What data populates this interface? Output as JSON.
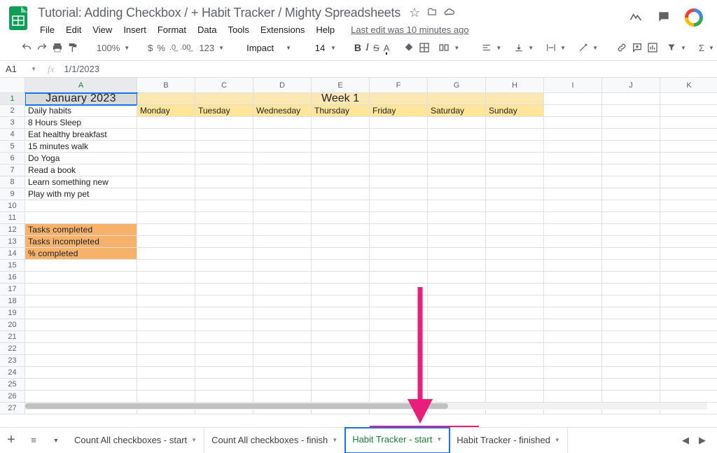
{
  "doc": {
    "title": "Tutorial: Adding Checkbox / + Habit Tracker / Mighty Spreadsheets"
  },
  "menu": [
    "File",
    "Edit",
    "View",
    "Insert",
    "Format",
    "Data",
    "Tools",
    "Extensions",
    "Help"
  ],
  "last_edit": "Last edit was 10 minutes ago",
  "toolbar": {
    "zoom": "100%",
    "font": "Impact",
    "size": "14"
  },
  "name_box": "A1",
  "formula": "1/1/2023",
  "columns": [
    "A",
    "B",
    "C",
    "D",
    "E",
    "F",
    "G",
    "H",
    "I",
    "J",
    "K"
  ],
  "rows": [
    "1",
    "2",
    "3",
    "4",
    "5",
    "6",
    "7",
    "8",
    "9",
    "10",
    "11",
    "12",
    "13",
    "14",
    "15",
    "16",
    "17",
    "18",
    "19",
    "20",
    "21",
    "22",
    "23",
    "24",
    "25",
    "26",
    "27"
  ],
  "cells": {
    "a1": "January 2023",
    "week": "Week 1",
    "a2": "Daily habits",
    "days": [
      "Monday",
      "Tuesday",
      "Wednesday",
      "Thursday",
      "Friday",
      "Saturday",
      "Sunday"
    ],
    "habits": [
      "8 Hours Sleep",
      "Eat healthy breakfast",
      "15 minutes walk",
      "Do Yoga",
      "Read a book",
      "Learn something new",
      "Play with my pet"
    ],
    "summary": [
      "Tasks completed",
      "Tasks incompleted",
      "% completed"
    ]
  },
  "tabs": [
    "Count All checkboxes - start",
    "Count All checkboxes - finish",
    "Habit Tracker - start",
    "Habit Tracker - finished"
  ],
  "active_tab_index": 2
}
